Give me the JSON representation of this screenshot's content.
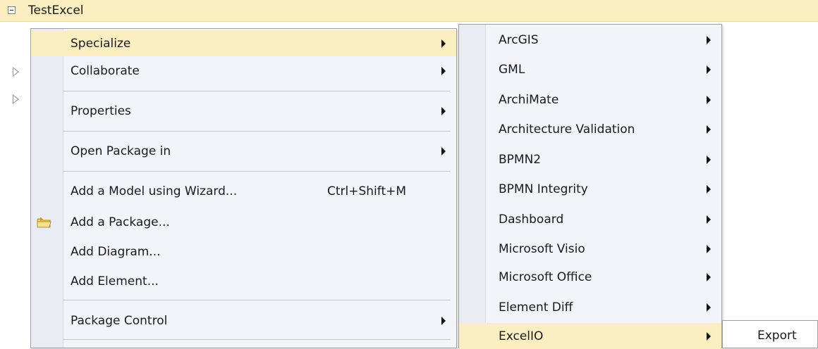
{
  "tree": {
    "title": "TestExcel"
  },
  "context_menu": {
    "items": [
      {
        "label": "Specialize",
        "has_submenu": true,
        "highlighted": true
      },
      {
        "label": "Collaborate",
        "has_submenu": true
      },
      {
        "label": "Properties",
        "has_submenu": true
      },
      {
        "label": "Open Package in",
        "has_submenu": true
      },
      {
        "label": "Add a Model using Wizard...",
        "shortcut": "Ctrl+Shift+M"
      },
      {
        "label": "Add a Package...",
        "icon": "folder-icon"
      },
      {
        "label": "Add Diagram..."
      },
      {
        "label": "Add Element..."
      },
      {
        "label": "Package Control",
        "has_submenu": true
      }
    ]
  },
  "specialize_menu": {
    "items": [
      {
        "label": "ArcGIS",
        "has_submenu": true
      },
      {
        "label": "GML",
        "has_submenu": true
      },
      {
        "label": "ArchiMate",
        "has_submenu": true
      },
      {
        "label": "Architecture Validation",
        "has_submenu": true
      },
      {
        "label": "BPMN2",
        "has_submenu": true
      },
      {
        "label": "BPMN Integrity",
        "has_submenu": true
      },
      {
        "label": "Dashboard",
        "has_submenu": true
      },
      {
        "label": "Microsoft Visio",
        "has_submenu": true
      },
      {
        "label": "Microsoft Office",
        "has_submenu": true
      },
      {
        "label": "Element Diff",
        "has_submenu": true
      },
      {
        "label": "ExcelIO",
        "has_submenu": true,
        "highlighted": true
      }
    ]
  },
  "excelio_menu": {
    "items": [
      {
        "label": "Export"
      }
    ]
  },
  "colors": {
    "highlight": "#fbefc2",
    "menu_background": "#f2f4fa",
    "menu_border": "#a0a0a0"
  }
}
